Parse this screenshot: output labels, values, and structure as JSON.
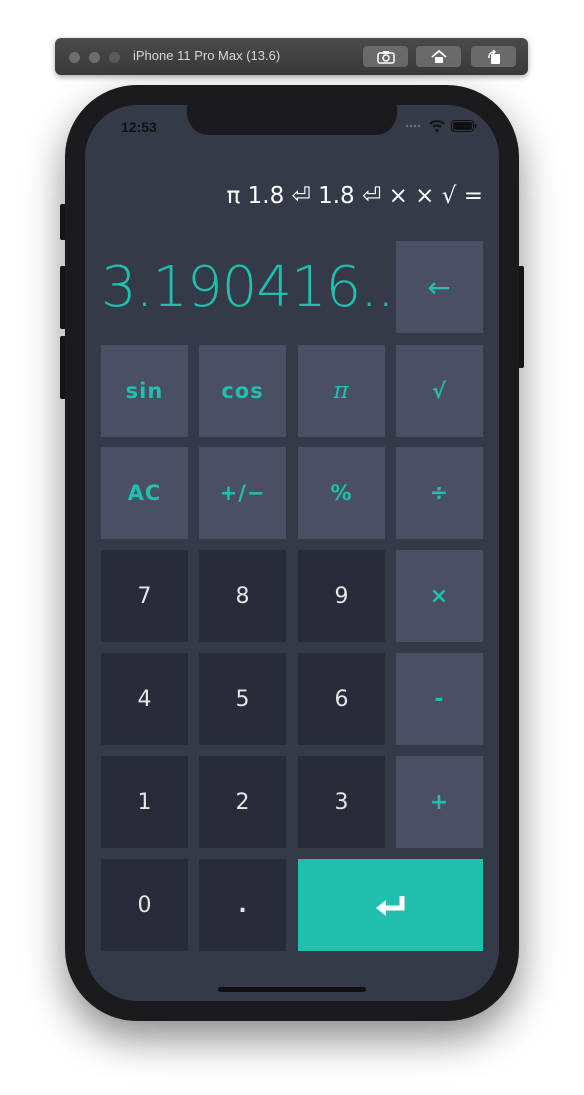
{
  "simulator": {
    "title": "iPhone 11 Pro Max (13.6)",
    "buttons": [
      "screenshot-icon",
      "home-icon",
      "rotate-icon"
    ]
  },
  "status_bar": {
    "time": "12:53",
    "icons": [
      "signal-dots",
      "wifi-icon",
      "battery-icon"
    ]
  },
  "calculator": {
    "history": "π 1.8 ⏎ 1.8 ⏎ × × √ =",
    "display": "3.190416...",
    "backspace_label": "←",
    "keys": {
      "sin": "sin",
      "cos": "cos",
      "pi": "π",
      "sqrt": "√",
      "ac": "AC",
      "negate": "+/−",
      "percent": "%",
      "divide": "÷",
      "seven": "7",
      "eight": "8",
      "nine": "9",
      "multiply": "×",
      "four": "4",
      "five": "5",
      "six": "6",
      "minus": "-",
      "one": "1",
      "two": "2",
      "three": "3",
      "plus": "+",
      "zero": "0",
      "decimal": "."
    },
    "enter_icon": "enter-icon"
  },
  "colors": {
    "accent": "#21bfad",
    "background": "#343a48",
    "function_key": "#4a4f63",
    "number_key": "#272b3a"
  }
}
